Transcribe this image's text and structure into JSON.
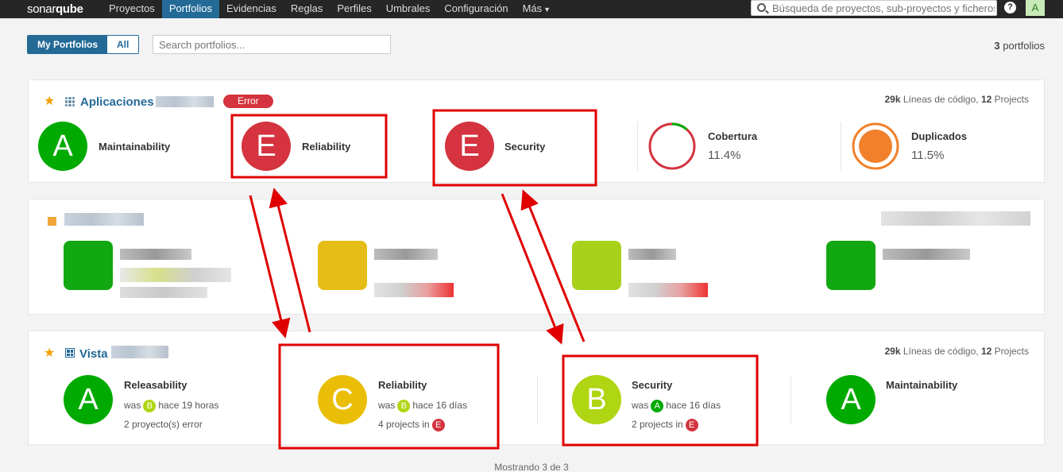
{
  "nav": {
    "logo_a": "sonar",
    "logo_b": "qube",
    "items": [
      {
        "label": "Proyectos",
        "active": false
      },
      {
        "label": "Portfolios",
        "active": true
      },
      {
        "label": "Evidencias",
        "active": false
      },
      {
        "label": "Reglas",
        "active": false
      },
      {
        "label": "Perfiles",
        "active": false
      },
      {
        "label": "Umbrales",
        "active": false
      },
      {
        "label": "Configuración",
        "active": false
      },
      {
        "label": "Más",
        "active": false
      }
    ],
    "search_placeholder": "Búsqueda de proyectos, sub-proyectos y ficheros...",
    "help": "?",
    "avatar": "A"
  },
  "toolbar": {
    "my_portfolios": "My Portfolios",
    "all": "All",
    "search_placeholder": "Search portfolios...",
    "count_number": "3",
    "count_label": " portfolios"
  },
  "card1": {
    "title": "Aplicaciones",
    "badge": "Error",
    "loc": "29k",
    "loc_label": " Líneas de código, ",
    "projects": "12",
    "projects_label": " Projects",
    "metrics": [
      {
        "rating": "A",
        "label": "Maintainability"
      },
      {
        "rating": "E",
        "label": "Reliability"
      },
      {
        "rating": "E",
        "label": "Security"
      }
    ],
    "coverage": {
      "label": "Cobertura",
      "value": "11.4%",
      "percent": 11.4
    },
    "duplications": {
      "label": "Duplicados",
      "value": "11.5%"
    }
  },
  "card3": {
    "title": "Vista",
    "loc": "29k",
    "loc_label": " Líneas de código, ",
    "projects": "12",
    "projects_label": " Projects",
    "metrics": [
      {
        "rating": "A",
        "label": "Releasability",
        "was_prefix": "was",
        "was": "B",
        "when": "hace 19 horas",
        "detail": "2 proyecto(s) error"
      },
      {
        "rating": "C",
        "label": "Reliability",
        "was_prefix": "was",
        "was": "B",
        "when": "hace 16 días",
        "detail_prefix": "4 projects in",
        "detail_rating": "E"
      },
      {
        "rating": "B",
        "label": "Security",
        "was_prefix": "was",
        "was": "A",
        "when": "hace 16 días",
        "detail_prefix": "2 projects in",
        "detail_rating": "E"
      },
      {
        "rating": "A",
        "label": "Maintainability"
      }
    ]
  },
  "footer": "Mostrando 3 de 3",
  "colors": {
    "A": "#00aa00",
    "B": "#b0d513",
    "C": "#eabe06",
    "E": "#d4333f",
    "annotation": "#e00000"
  }
}
